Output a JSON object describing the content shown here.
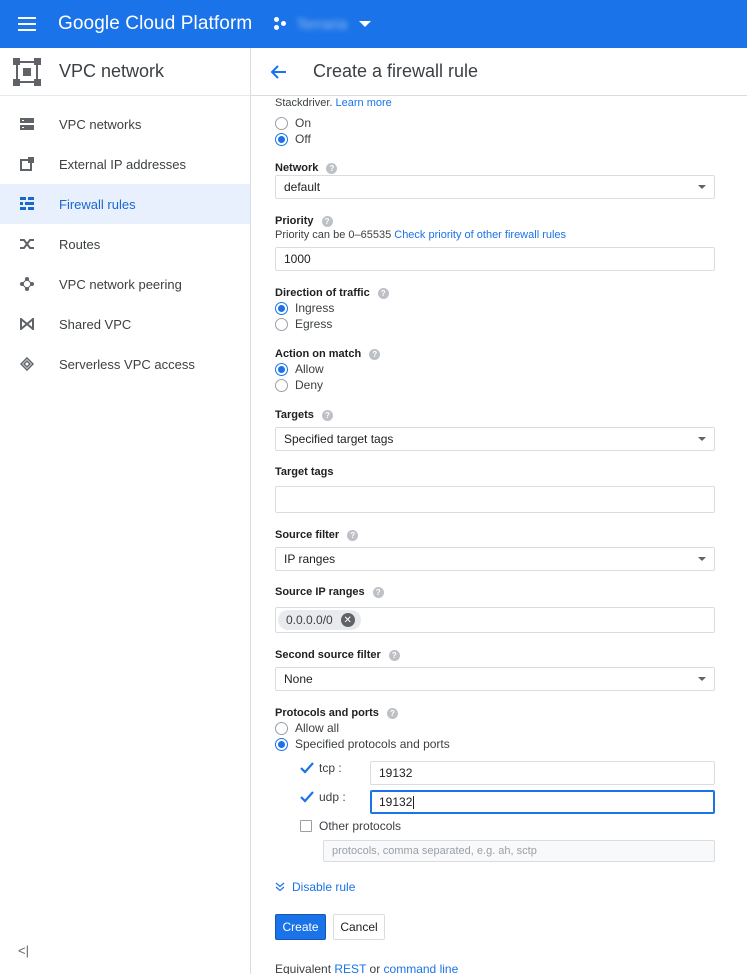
{
  "app": {
    "name": "Google Cloud Platform",
    "project": "Terraria"
  },
  "sidebar": {
    "title": "VPC network",
    "items": [
      {
        "label": "VPC networks",
        "icon": "vpc-networks-icon"
      },
      {
        "label": "External IP addresses",
        "icon": "external-ip-icon"
      },
      {
        "label": "Firewall rules",
        "icon": "firewall-icon",
        "active": true
      },
      {
        "label": "Routes",
        "icon": "routes-icon"
      },
      {
        "label": "VPC network peering",
        "icon": "peering-icon"
      },
      {
        "label": "Shared VPC",
        "icon": "shared-vpc-icon"
      },
      {
        "label": "Serverless VPC access",
        "icon": "serverless-icon"
      }
    ],
    "collapse_label": "<|"
  },
  "page": {
    "title": "Create a firewall rule"
  },
  "form": {
    "logs_note": "Stackdriver.",
    "logs_learn_more": "Learn more",
    "logs_options": [
      "On",
      "Off"
    ],
    "logs_selected": "Off",
    "network": {
      "label": "Network",
      "value": "default"
    },
    "priority": {
      "label": "Priority",
      "hint": "Priority can be 0–65535",
      "hint_link": "Check priority of other firewall rules",
      "value": "1000"
    },
    "direction": {
      "label": "Direction of traffic",
      "options": [
        "Ingress",
        "Egress"
      ],
      "selected": "Ingress"
    },
    "action": {
      "label": "Action on match",
      "options": [
        "Allow",
        "Deny"
      ],
      "selected": "Allow"
    },
    "targets": {
      "label": "Targets",
      "value": "Specified target tags"
    },
    "target_tags": {
      "label": "Target tags",
      "value": ""
    },
    "source_filter": {
      "label": "Source filter",
      "value": "IP ranges"
    },
    "source_ip_ranges": {
      "label": "Source IP ranges",
      "chips": [
        "0.0.0.0/0"
      ]
    },
    "second_source_filter": {
      "label": "Second source filter",
      "value": "None"
    },
    "protocols": {
      "label": "Protocols and ports",
      "options": [
        "Allow all",
        "Specified protocols and ports"
      ],
      "selected": "Specified protocols and ports",
      "tcp_label": "tcp :",
      "tcp_value": "19132",
      "udp_label": "udp :",
      "udp_value": "19132",
      "other_label": "Other protocols",
      "other_placeholder": "protocols, comma separated, e.g. ah, sctp"
    },
    "disable_rule": "Disable rule",
    "create_label": "Create",
    "cancel_label": "Cancel",
    "equivalent_prefix": "Equivalent",
    "equivalent_rest": "REST",
    "equivalent_or": "or",
    "equivalent_cli": "command line"
  }
}
